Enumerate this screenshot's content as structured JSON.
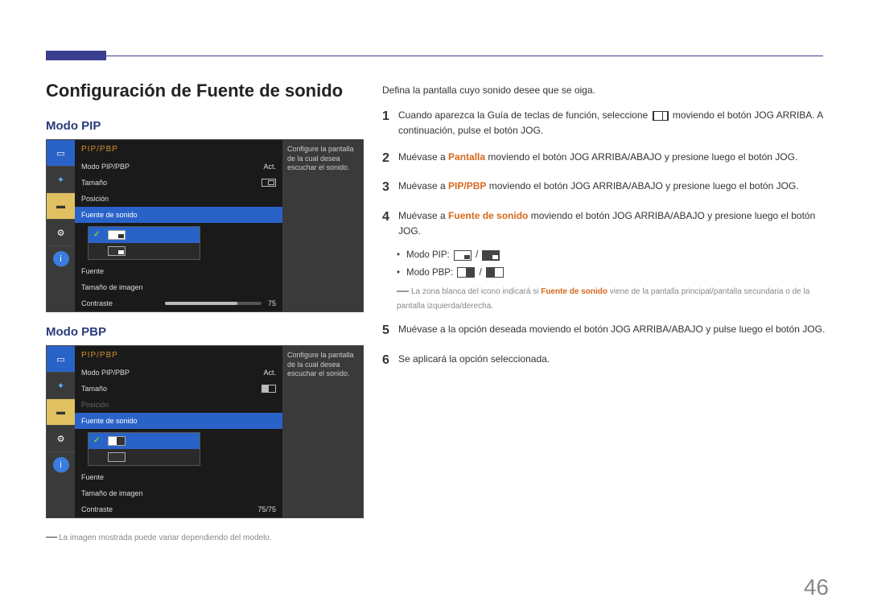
{
  "page_number": "46",
  "section_title": "Configuración de Fuente de sonido",
  "mode_pip_heading": "Modo PIP",
  "mode_pbp_heading": "Modo PBP",
  "osd": {
    "header": "PIP/PBP",
    "row_mode": "Modo PIP/PBP",
    "row_mode_val": "Act.",
    "row_tamano": "Tamaño",
    "row_posicion": "Posición",
    "row_fuente_sonido": "Fuente de sonido",
    "row_fuente": "Fuente",
    "row_tam_imagen": "Tamaño de imagen",
    "row_contraste": "Contraste",
    "contraste_val_pip": "75",
    "contraste_val_pbp": "75/75",
    "help_text": "Configure la pantalla de la cual desea escuchar el sonido."
  },
  "footnote_img": "La imagen mostrada puede variar dependiendo del modelo.",
  "right": {
    "intro": "Defina la pantalla cuyo sonido desee que se oiga.",
    "step1_a": "Cuando aparezca la Guía de teclas de función, seleccione ",
    "step1_b": " moviendo el botón JOG ARRIBA. A continuación, pulse el botón JOG.",
    "step2_a": "Muévase a ",
    "step2_hl": "Pantalla",
    "step2_b": " moviendo el botón JOG ARRIBA/ABAJO y presione luego el botón JOG.",
    "step3_a": "Muévase a ",
    "step3_hl": "PIP/PBP",
    "step3_b": " moviendo el botón JOG ARRIBA/ABAJO y presione luego el botón JOG.",
    "step4_a": "Muévase a ",
    "step4_hl": "Fuente de sonido",
    "step4_b": " moviendo el botón JOG ARRIBA/ABAJO y presione luego el botón JOG.",
    "bullet_pip": "Modo PIP: ",
    "bullet_pbp": "Modo PBP: ",
    "icon_note_a": "La zona blanca del icono indicará si ",
    "icon_note_hl": "Fuente de sonido",
    "icon_note_b": " viene de la pantalla principal/pantalla secundaria o de la pantalla izquierda/derecha.",
    "step5": "Muévase a la opción deseada moviendo el botón JOG ARRIBA/ABAJO y pulse luego el botón JOG.",
    "step6": "Se aplicará la opción seleccionada.",
    "sep": " / "
  }
}
